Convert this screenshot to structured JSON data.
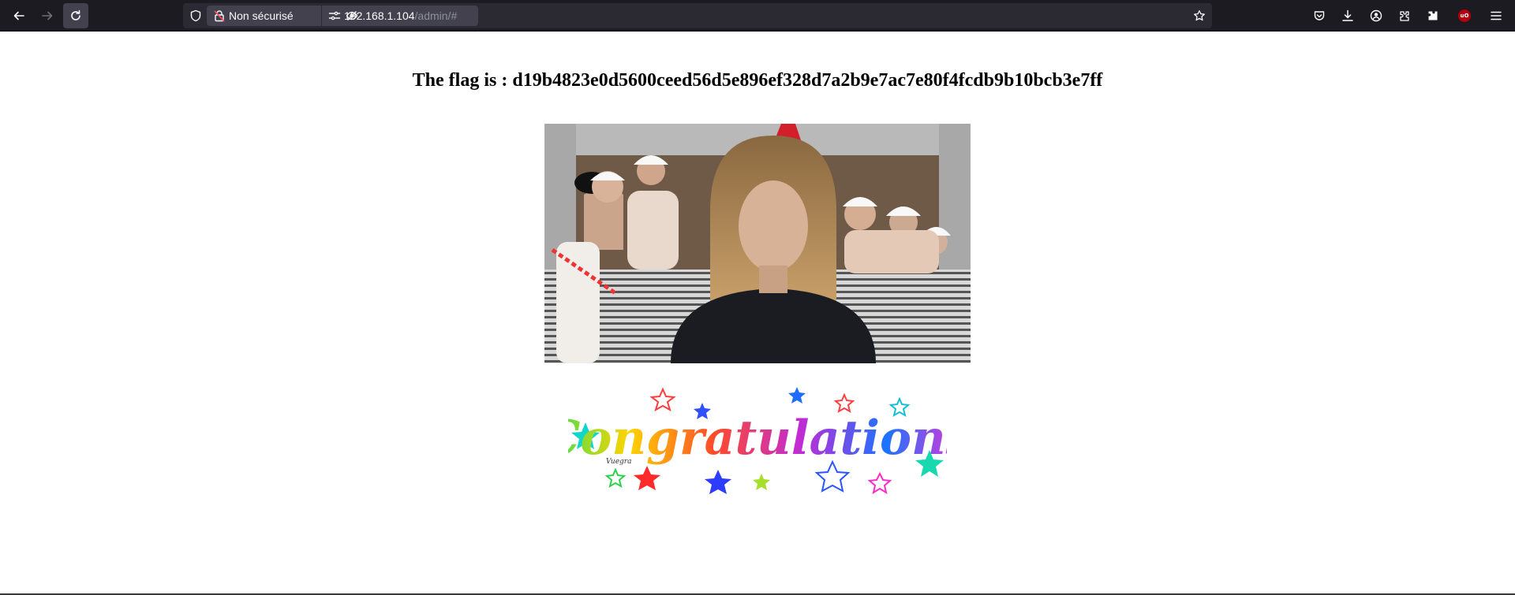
{
  "browser": {
    "security_label": "Non sécurisé",
    "url_host": "192.168.1.104",
    "url_path": "/admin/#",
    "icons": [
      "back-arrow-icon",
      "forward-arrow-icon",
      "reload-icon",
      "shield-icon",
      "insecure-lock-icon",
      "permissions-icon",
      "tracking-off-icon",
      "bookmark-star-icon",
      "pocket-icon",
      "download-icon",
      "account-icon",
      "extensions-icon",
      "extension-puzzle-icon",
      "ublock-icon",
      "menu-icon"
    ],
    "ublock_badge": "uO"
  },
  "page": {
    "flag_text": "The flag is : d19b4823e0d5600ceed56d5e896ef328d7a2b9e7ac7e80f4fcdb9b10bcb3e7ff",
    "image_alt": "celebration gif",
    "banner_text": "Congratulations",
    "banner_signature": "Vuegra"
  }
}
